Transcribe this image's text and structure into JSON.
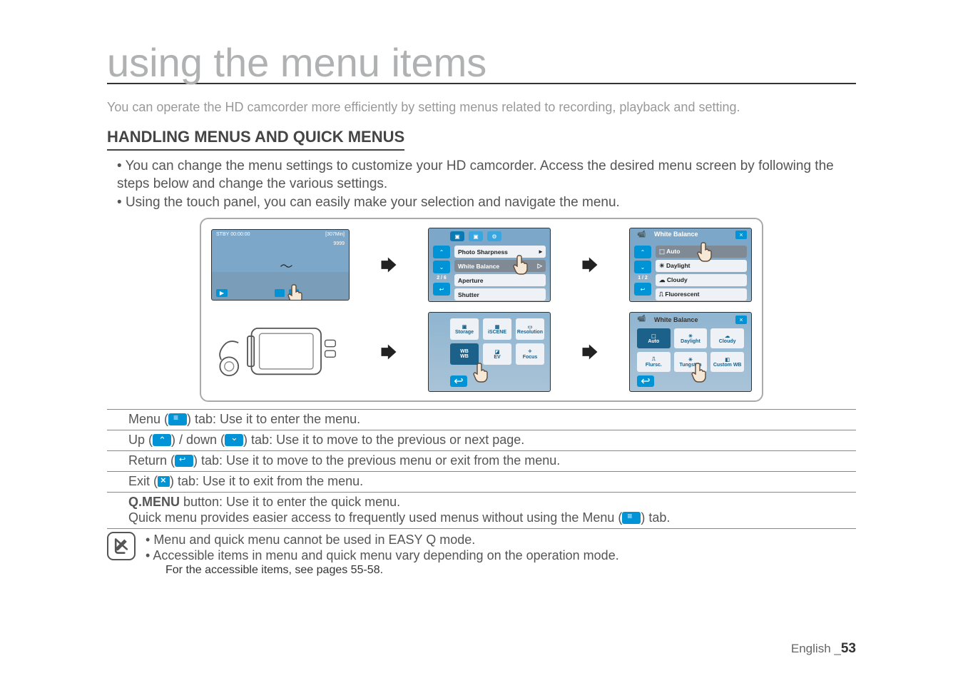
{
  "title": "using the menu items",
  "intro": "You can operate the HD camcorder more efficiently by setting menus related to recording, playback and setting.",
  "section_heading": "HANDLING MENUS AND QUICK MENUS",
  "bullets": [
    "You can change the menu settings to customize your HD camcorder. Access the desired menu screen by following the steps below and change the various settings.",
    "Using the touch panel, you can easily make your selection and navigate the menu."
  ],
  "diagram": {
    "row1": {
      "screen1": {
        "stby": "STBY",
        "time": "00:00:00",
        "rem": "[307Min]",
        "count": "9999"
      },
      "screen2": {
        "items": [
          "Photo Sharpness",
          "White Balance",
          "Aperture",
          "Shutter"
        ],
        "page": "2 / 6"
      },
      "screen3": {
        "title": "White Balance",
        "items": [
          "Auto",
          "Daylight",
          "Cloudy",
          "Fluorescent"
        ],
        "page": "1 / 2"
      }
    },
    "row2": {
      "qmenu": {
        "items": [
          "Storage",
          "iSCENE",
          "Resolution",
          "WB",
          "EV",
          "Focus"
        ]
      },
      "wbgrid": {
        "title": "White Balance",
        "items": [
          "Auto",
          "Daylight",
          "Cloudy",
          "Flursc.",
          "Tungsten",
          "Custom WB"
        ]
      }
    }
  },
  "exp_rows": {
    "menu_pre": "Menu (",
    "menu_post": ") tab: Use it to enter the menu.",
    "up_pre": "Up (",
    "up_mid": ") / down (",
    "up_post": ") tab: Use it to move to the previous or next page.",
    "ret_pre": "Return (",
    "ret_post": ") tab: Use it to move to the previous menu or exit from the menu.",
    "exit_pre": "Exit (",
    "exit_post": ") tab: Use it to exit from the menu.",
    "qmenu_bold": "Q.MENU",
    "qmenu_line1": " button: Use it to enter the quick menu.",
    "qmenu_line2a": "Quick menu provides easier access to frequently used menus without using the Menu (",
    "qmenu_line2b": ") tab."
  },
  "notes": [
    "Menu and quick menu cannot be used in EASY Q mode.",
    "Accessible items in menu and quick menu vary depending on the operation mode.",
    "For the accessible items, see pages 55-58."
  ],
  "footer": {
    "lang": "English",
    "sep": "_",
    "page": "53"
  }
}
